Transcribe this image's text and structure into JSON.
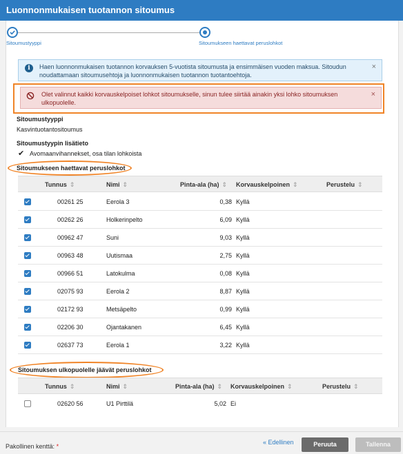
{
  "window": {
    "title": "Luonnonmukaisen tuotannon sitoumus"
  },
  "stepper": {
    "steps": [
      {
        "label": "Sitoumustyyppi",
        "state": "done"
      },
      {
        "label": "Sitoumukseen haettavat peruslohkot",
        "state": "active"
      }
    ]
  },
  "alerts": {
    "info": "Haen luonnonmukaisen tuotannon korvauksen 5-vuotista sitoumusta ja ensimmäisen vuoden maksua. Sitoudun noudattamaan sitoumusehtoja ja luonnonmukaisen tuotannon tuotantoehtoja.",
    "error": "Olet valinnut kaikki korvauskelpoiset lohkot sitoumukselle, sinun tulee siirtää ainakin yksi lohko sitoumuksen ulkopuolelle.",
    "close_glyph": "×"
  },
  "commitment": {
    "type_label": "Sitoumustyyppi",
    "type_value": "Kasvintuotantositoumus",
    "extra_label": "Sitoumustyypin lisätieto",
    "extra_value": "Avomaanvihannekset, osa tilan lohkoista"
  },
  "included": {
    "heading": "Sitoumukseen haettavat peruslohkot",
    "columns": [
      "Tunnus",
      "Nimi",
      "Pinta-ala (ha)",
      "Korvauskelpoinen",
      "Perustelu"
    ],
    "rows": [
      {
        "checked": true,
        "id": "00261 25",
        "name": "Eerola 3",
        "area": "0,38",
        "eligible": "Kyllä"
      },
      {
        "checked": true,
        "id": "00262 26",
        "name": "Holkerinpelto",
        "area": "6,09",
        "eligible": "Kyllä"
      },
      {
        "checked": true,
        "id": "00962 47",
        "name": "Suni",
        "area": "9,03",
        "eligible": "Kyllä"
      },
      {
        "checked": true,
        "id": "00963 48",
        "name": "Uutismaa",
        "area": "2,75",
        "eligible": "Kyllä"
      },
      {
        "checked": true,
        "id": "00966 51",
        "name": "Latokulma",
        "area": "0,08",
        "eligible": "Kyllä"
      },
      {
        "checked": true,
        "id": "02075 93",
        "name": "Eerola 2",
        "area": "8,87",
        "eligible": "Kyllä"
      },
      {
        "checked": true,
        "id": "02172 93",
        "name": "Metsäpelto",
        "area": "0,99",
        "eligible": "Kyllä"
      },
      {
        "checked": true,
        "id": "02206 30",
        "name": "Ojantakanen",
        "area": "6,45",
        "eligible": "Kyllä"
      },
      {
        "checked": true,
        "id": "02637 73",
        "name": "Eerola 1",
        "area": "3,22",
        "eligible": "Kyllä"
      }
    ]
  },
  "excluded": {
    "heading": "Sitoumuksen ulkopuolelle jäävät peruslohkot",
    "columns": [
      "Tunnus",
      "Nimi",
      "Pinta-ala (ha)",
      "Korvauskelpoinen",
      "Perustelu"
    ],
    "rows": [
      {
        "checked": false,
        "id": "02620 56",
        "name": "U1 Pirttilä",
        "area": "5,02",
        "eligible": "Ei"
      }
    ]
  },
  "footer": {
    "required_label": "Pakollinen kenttä:",
    "required_star": "*",
    "prev": "« Edellinen",
    "cancel": "Peruuta",
    "save": "Tallenna"
  },
  "colors": {
    "accent": "#2e7cc2",
    "highlight": "#f08427",
    "error_bg": "#f5dcdc",
    "info_bg": "#e3f1fb"
  }
}
